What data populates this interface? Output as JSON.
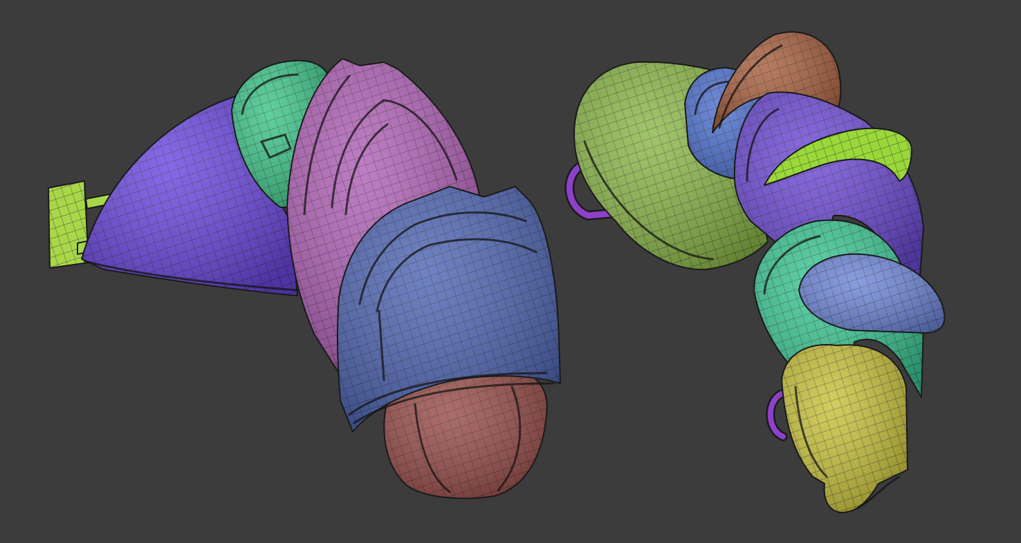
{
  "scene": {
    "background": "#3c3c3c",
    "wireframe_color": "#1e1e1e",
    "models": [
      {
        "name": "shoulder-armor-left",
        "pieces": [
          {
            "name": "yellow-buckle-strap",
            "color": "#a8d84a"
          },
          {
            "name": "purple-back-plate",
            "color": "#6b48e0"
          },
          {
            "name": "green-upper-plate",
            "color": "#3ec58a"
          },
          {
            "name": "magenta-middle-plate",
            "color": "#b061b6"
          },
          {
            "name": "blue-front-pauldron",
            "color": "#4f66b4"
          },
          {
            "name": "red-inner-plate",
            "color": "#9a4e4a"
          }
        ]
      },
      {
        "name": "shoulder-armor-right",
        "pieces": [
          {
            "name": "olive-green-plate",
            "color": "#8cb84a"
          },
          {
            "name": "purple-loop",
            "color": "#8d40c8"
          },
          {
            "name": "blue-top-plate",
            "color": "#4f72d0"
          },
          {
            "name": "brown-fin",
            "color": "#a8603e"
          },
          {
            "name": "violet-mid-plate",
            "color": "#6e4bd6"
          },
          {
            "name": "lime-fin",
            "color": "#9ad83a"
          },
          {
            "name": "teal-lower-plate",
            "color": "#3dc895"
          },
          {
            "name": "periwinkle-plate",
            "color": "#6f87d8"
          },
          {
            "name": "yellow-bottom-plate",
            "color": "#c9c23c"
          },
          {
            "name": "purple-small-loop",
            "color": "#8d40c8"
          }
        ]
      }
    ]
  }
}
